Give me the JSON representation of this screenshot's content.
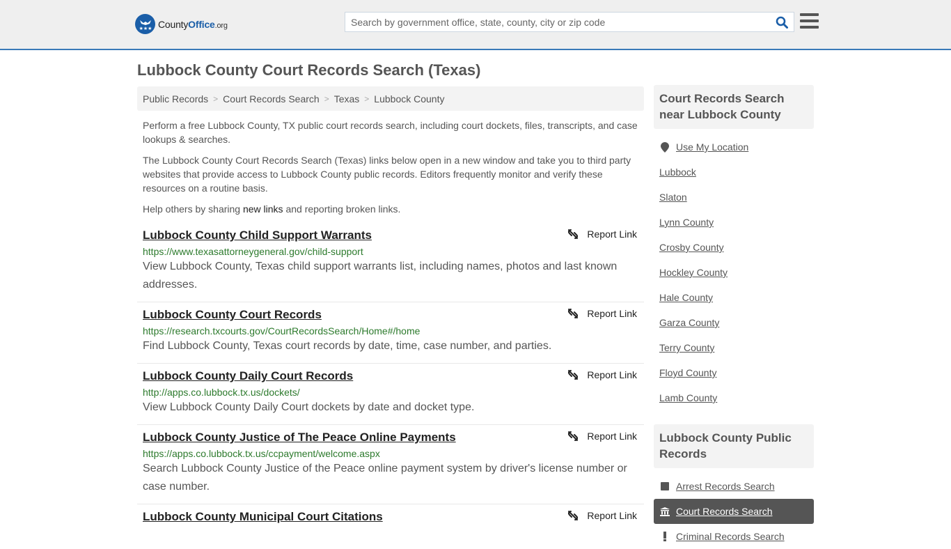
{
  "header": {
    "logo": {
      "name_part1": "County",
      "name_part2": "Office",
      "name_part3": ".org"
    },
    "search": {
      "placeholder": "Search by government office, state, county, city or zip code",
      "value": ""
    }
  },
  "page": {
    "title": "Lubbock County Court Records Search (Texas)"
  },
  "breadcrumb": [
    {
      "label": "Public Records"
    },
    {
      "label": "Court Records Search"
    },
    {
      "label": "Texas"
    },
    {
      "label": "Lubbock County"
    }
  ],
  "intro": {
    "p1": "Perform a free Lubbock County, TX public court records search, including court dockets, files, transcripts, and case lookups & searches.",
    "p2": "The Lubbock County Court Records Search (Texas) links below open in a new window and take you to third party websites that provide access to Lubbock County public records. Editors frequently monitor and verify these resources on a routine basis.",
    "p3_before": "Help others by sharing ",
    "p3_link": "new links",
    "p3_after": " and reporting broken links."
  },
  "report_label": "Report Link",
  "results": [
    {
      "title": "Lubbock County Child Support Warrants",
      "url": "https://www.texasattorneygeneral.gov/child-support",
      "desc": "View Lubbock County, Texas child support warrants list, including names, photos and last known addresses."
    },
    {
      "title": "Lubbock County Court Records",
      "url": "https://research.txcourts.gov/CourtRecordsSearch/Home#/home",
      "desc": "Find Lubbock County, Texas court records by date, time, case number, and parties."
    },
    {
      "title": "Lubbock County Daily Court Records",
      "url": "http://apps.co.lubbock.tx.us/dockets/",
      "desc": "View Lubbock County Daily Court dockets by date and docket type."
    },
    {
      "title": "Lubbock County Justice of The Peace Online Payments",
      "url": "https://apps.co.lubbock.tx.us/ccpayment/welcome.aspx",
      "desc": "Search Lubbock County Justice of the Peace online payment system by driver's license number or case number."
    },
    {
      "title": "Lubbock County Municipal Court Citations",
      "url": "",
      "desc": ""
    }
  ],
  "sidebar": {
    "nearby": {
      "heading": "Court Records Search near Lubbock County",
      "use_location": "Use My Location",
      "items": [
        "Lubbock",
        "Slaton",
        "Lynn County",
        "Crosby County",
        "Hockley County",
        "Hale County",
        "Garza County",
        "Terry County",
        "Floyd County",
        "Lamb County"
      ]
    },
    "public_records": {
      "heading": "Lubbock County Public Records",
      "items": [
        {
          "label": "Arrest Records Search",
          "icon": "square-icon",
          "active": false
        },
        {
          "label": "Court Records Search",
          "icon": "courthouse-icon",
          "active": true
        },
        {
          "label": "Criminal Records Search",
          "icon": "exclamation-icon",
          "active": false
        }
      ]
    }
  },
  "colors": {
    "brand_blue": "#1a5ea8",
    "url_green": "#2c7a2c",
    "header_border": "#3a7ab8",
    "active_bg": "#555555"
  }
}
